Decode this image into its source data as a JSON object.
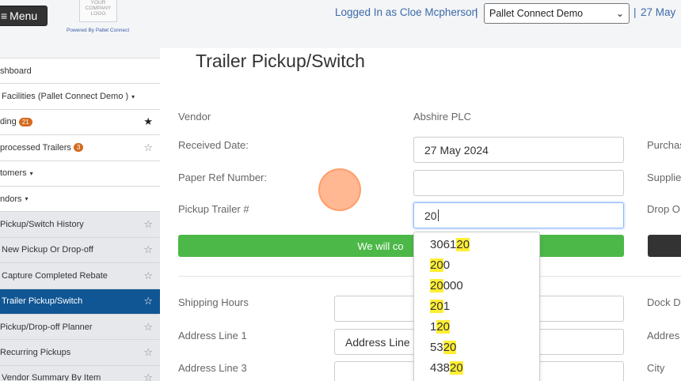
{
  "header": {
    "menu_label": "Menu",
    "logo_text": "YOUR COMPANY LOGO",
    "powered_by": "Powered By Pallet Connect",
    "logged_in": "Logged In as Cloe Mcpherson",
    "site_selected": "Pallet Connect Demo",
    "date": "27 May",
    "separator": "|"
  },
  "sidebar": {
    "items": [
      {
        "label": "shboard",
        "star": "",
        "badge": ""
      },
      {
        "label": "Facilities (Pallet Connect Demo )",
        "star": "",
        "badge": "",
        "caret": "▾"
      },
      {
        "label": "ding",
        "star": "★",
        "badge": "21"
      },
      {
        "label": "processed Trailers",
        "star": "☆",
        "badge": "3"
      },
      {
        "label": "tomers",
        "star": "",
        "badge": "",
        "caret": "▾"
      },
      {
        "label": "ndors",
        "star": "",
        "badge": "",
        "caret": "▾"
      },
      {
        "label": "Pickup/Switch History",
        "star": "☆",
        "badge": ""
      },
      {
        "label": "New Pickup Or Drop-off",
        "star": "☆",
        "badge": ""
      },
      {
        "label": "Capture Completed Rebate",
        "star": "☆",
        "badge": ""
      },
      {
        "label": "Trailer Pickup/Switch",
        "star": "☆",
        "badge": ""
      },
      {
        "label": "Pickup/Drop-off Planner",
        "star": "☆",
        "badge": ""
      },
      {
        "label": "Recurring Pickups",
        "star": "☆",
        "badge": ""
      },
      {
        "label": "Vendor Summary By Item",
        "star": "☆",
        "badge": ""
      }
    ]
  },
  "main": {
    "title": "Trailer Pickup/Switch",
    "vendor_label": "Vendor",
    "vendor_value": "Abshire PLC",
    "received_date_label": "Received Date:",
    "received_date_value": "27 May 2024",
    "paper_ref_label": "Paper Ref Number:",
    "paper_ref_value": "",
    "pickup_trailer_label": "Pickup Trailer #",
    "pickup_trailer_value": "20",
    "right_labels": [
      "Purchas",
      "Supplie",
      "Drop O"
    ],
    "green_button_text": "We will co",
    "shipping_hours_label": "Shipping Hours",
    "address1_label": "Address Line 1",
    "address1_value": "Address Line 1",
    "address3_label": "Address Line 3",
    "right_labels_lower": [
      "Dock D",
      "Addres",
      "City"
    ]
  },
  "autocomplete": {
    "query": "20",
    "options": [
      {
        "pre": "3061",
        "match": "20",
        "post": ""
      },
      {
        "pre": "",
        "match": "20",
        "post": "0"
      },
      {
        "pre": "",
        "match": "20",
        "post": "000"
      },
      {
        "pre": "",
        "match": "20",
        "post": "1"
      },
      {
        "pre": "1",
        "match": "20",
        "post": ""
      },
      {
        "pre": "53",
        "match": "20",
        "post": ""
      },
      {
        "pre": "438",
        "match": "20",
        "post": ""
      }
    ]
  },
  "colors": {
    "active_nav": "#105694",
    "badge": "#d46a1e",
    "green": "#4cb848",
    "highlight": "#ffee33",
    "link": "#3b6aa8"
  }
}
